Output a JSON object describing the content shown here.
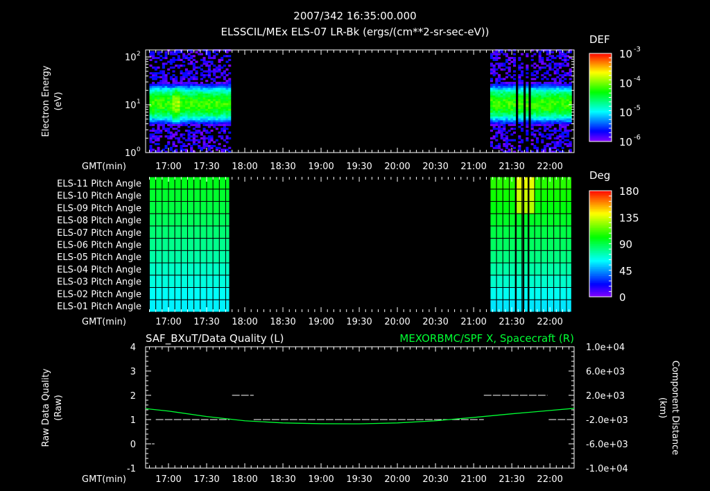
{
  "header": {
    "time": "2007/342 16:35:00.000",
    "title": "ELSSCIL/MEx ELS-07 LR-Bk  (ergs/(cm**2-sr-sec-eV))"
  },
  "time_axis": {
    "label": "GMT(min)",
    "ticks": [
      "17:00",
      "17:30",
      "18:00",
      "18:30",
      "19:00",
      "19:30",
      "20:00",
      "20:30",
      "21:00",
      "21:30",
      "22:00"
    ],
    "range": [
      "16:42",
      "22:19"
    ]
  },
  "chart_data": [
    {
      "type": "heatmap",
      "name": "energy-spectrogram",
      "ylabel": [
        "Electron Energy",
        "(eV)"
      ],
      "yscale": "log",
      "ylim": [
        1,
        140
      ],
      "yticks": [
        {
          "base": "10",
          "exp": "0",
          "value": 1
        },
        {
          "base": "10",
          "exp": "1",
          "value": 10
        },
        {
          "base": "10",
          "exp": "2",
          "value": 100
        }
      ],
      "data_segments": [
        {
          "start": "16:45",
          "end": "17:48"
        },
        {
          "start": "21:13",
          "end": "22:17"
        }
      ],
      "data_gaps": [
        "21:33",
        "21:39",
        "21:43"
      ],
      "peak_energy_eV": 10,
      "peak_log_def": -4.2,
      "enhancement": {
        "time": "17:05",
        "log_def": -3.9
      },
      "colorbar": {
        "title": "DEF",
        "log_range": [
          -6,
          -3
        ],
        "ticks": [
          {
            "base": "10",
            "exp": "-3"
          },
          {
            "base": "10",
            "exp": "-4"
          },
          {
            "base": "10",
            "exp": "-5"
          },
          {
            "base": "10",
            "exp": "-6"
          }
        ]
      }
    },
    {
      "type": "heatmap",
      "name": "pitch-angle",
      "rows": [
        "ELS-11 Pitch Angle",
        "ELS-10 Pitch Angle",
        "ELS-09 Pitch Angle",
        "ELS-08 Pitch Angle",
        "ELS-07 Pitch Angle",
        "ELS-06 Pitch Angle",
        "ELS-05 Pitch Angle",
        "ELS-04 Pitch Angle",
        "ELS-03 Pitch Angle",
        "ELS-02 Pitch Angle",
        "ELS-01 Pitch Angle"
      ],
      "segments": [
        {
          "start": "16:45",
          "end": "17:48",
          "values_deg": [
            96,
            93,
            90,
            86,
            82,
            78,
            74,
            69,
            65,
            61,
            58
          ]
        },
        {
          "start": "21:13",
          "end": "22:17",
          "values_deg": [
            106,
            102,
            98,
            94,
            89,
            85,
            80,
            74,
            68,
            62,
            56
          ]
        }
      ],
      "data_gaps": [
        "21:33",
        "21:39",
        "21:43"
      ],
      "colorbar": {
        "title": "Deg",
        "range": [
          0,
          180
        ],
        "ticks": [
          "180",
          "135",
          "90",
          "45",
          "0"
        ]
      }
    },
    {
      "type": "line",
      "name": "data-quality-and-distance",
      "title_left": "SAF_BXuT/Data Quality (L)",
      "title_right": "MEXORBMC/SPF X, Spacecraft (R)",
      "ylabel_left": [
        "Raw Data Quality",
        "(Raw)"
      ],
      "ylabel_right": [
        "Component Distance",
        "(km)"
      ],
      "ylim_left": [
        -1,
        4
      ],
      "yticks_left": [
        "4",
        "3",
        "2",
        "1",
        "0",
        "-1"
      ],
      "ylim_right": [
        -10000,
        10000
      ],
      "yticks_right": [
        "1.0e+04",
        "6.0e+03",
        "2.0e+03",
        "-2.0e+03",
        "-6.0e+03",
        "-1.0e+04"
      ],
      "quality_segments": [
        {
          "start": "16:47",
          "end": "16:49",
          "value": 0
        },
        {
          "start": "16:50",
          "end": "17:48",
          "value": 1
        },
        {
          "start": "17:50",
          "end": "18:07",
          "value": 2
        },
        {
          "start": "18:07",
          "end": "21:08",
          "value": 1
        },
        {
          "start": "21:08",
          "end": "21:58",
          "value": 2
        },
        {
          "start": "21:59",
          "end": "22:16",
          "value": 1
        }
      ],
      "distance_series": {
        "color": "#00ff33",
        "x": [
          "16:42",
          "17:00",
          "17:30",
          "18:00",
          "18:30",
          "19:00",
          "19:30",
          "20:00",
          "20:30",
          "21:00",
          "21:30",
          "22:00",
          "22:19"
        ],
        "y": [
          -200,
          -600,
          -1500,
          -2200,
          -2550,
          -2680,
          -2700,
          -2550,
          -2200,
          -1650,
          -1050,
          -500,
          -150
        ]
      }
    }
  ]
}
